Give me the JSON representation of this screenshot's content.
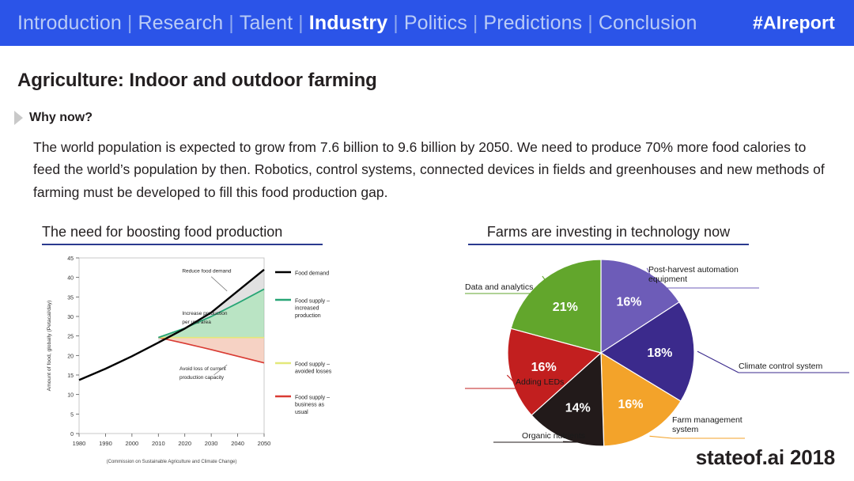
{
  "nav": {
    "items": [
      {
        "label": "Introduction",
        "active": false
      },
      {
        "label": "Research",
        "active": false
      },
      {
        "label": "Talent",
        "active": false
      },
      {
        "label": "Industry",
        "active": true
      },
      {
        "label": "Politics",
        "active": false
      },
      {
        "label": "Predictions",
        "active": false
      },
      {
        "label": "Conclusion",
        "active": false
      }
    ],
    "separator": "|",
    "hashtag": "#AIreport",
    "bar_color": "#2b54e8",
    "inactive_color": "#b9cbf6",
    "active_color": "#ffffff"
  },
  "slide": {
    "title": "Agriculture: Indoor and outdoor farming",
    "bullet_label": "Why now?",
    "body": "The world population is expected to grow from 7.6 billion to 9.6 billion by 2050. We need to produce 70% more food calories to feed the world’s population by then. Robotics, control systems, connected devices in fields and greenhouses and new methods of farming must be developed to fill this food production gap.",
    "brand": "stateof.ai 2018",
    "accent_color": "#2a3a8f"
  },
  "left_panel": {
    "heading": "The need for boosting food production"
  },
  "right_panel": {
    "heading": "Farms are investing in technology now"
  },
  "chart_data": [
    {
      "type": "line",
      "title": "The need for boosting food production",
      "xlabel": "",
      "ylabel": "Amount of food, globally (Petacal/day)",
      "caption": "(Commission on Sustainable Agriculture and Climate Change)",
      "xlim": [
        1980,
        2050
      ],
      "ylim": [
        0,
        45
      ],
      "xticks": [
        1980,
        1990,
        2000,
        2010,
        2020,
        2030,
        2040,
        2050
      ],
      "yticks": [
        0,
        5,
        10,
        15,
        20,
        25,
        30,
        35,
        40,
        45
      ],
      "grid": false,
      "legend_position": "right",
      "annotations": [
        {
          "text": "Reduce food demand",
          "x": 2032,
          "y": 40
        },
        {
          "text": "Increase production per unit area",
          "x": 2026,
          "y": 29
        },
        {
          "text": "Avoid loss of current production capacity",
          "x": 2027,
          "y": 17
        }
      ],
      "series": [
        {
          "name": "Food demand",
          "color": "#000000",
          "x": [
            1980,
            1990,
            2000,
            2010,
            2020,
            2030,
            2040,
            2050
          ],
          "values": [
            13.7,
            16.6,
            19.8,
            23.3,
            26.9,
            31.0,
            36.5,
            42.0
          ]
        },
        {
          "name": "Food supply – increased production",
          "color": "#27a575",
          "x": [
            2010,
            2020,
            2030,
            2040,
            2050
          ],
          "values": [
            24.6,
            27.0,
            30.0,
            33.4,
            37.0
          ]
        },
        {
          "name": "Food supply – avoided losses",
          "color": "#e3e87a",
          "x": [
            2010,
            2020,
            2030,
            2040,
            2050
          ],
          "values": [
            24.6,
            24.6,
            24.6,
            24.6,
            24.6
          ]
        },
        {
          "name": "Food supply – business as usual",
          "color": "#d93b33",
          "x": [
            2010,
            2020,
            2030,
            2040,
            2050
          ],
          "values": [
            24.6,
            23.1,
            21.5,
            19.8,
            18.1
          ]
        }
      ]
    },
    {
      "type": "pie",
      "title": "Farms are investing in technology now",
      "legend_position": "callouts",
      "labels": [
        "Post-harvest automation equipment",
        "Climate control system",
        "Farm management system",
        "Organic nutrients",
        "Adding LEDs",
        "Data and analytics"
      ],
      "values": [
        16,
        18,
        16,
        14,
        16,
        21
      ],
      "value_labels": [
        "16%",
        "18%",
        "16%",
        "14%",
        "16%",
        "21%"
      ],
      "colors": [
        "#6d5cb8",
        "#3b2a8c",
        "#f3a32a",
        "#221a1a",
        "#c21f1f",
        "#62a62c"
      ]
    }
  ]
}
